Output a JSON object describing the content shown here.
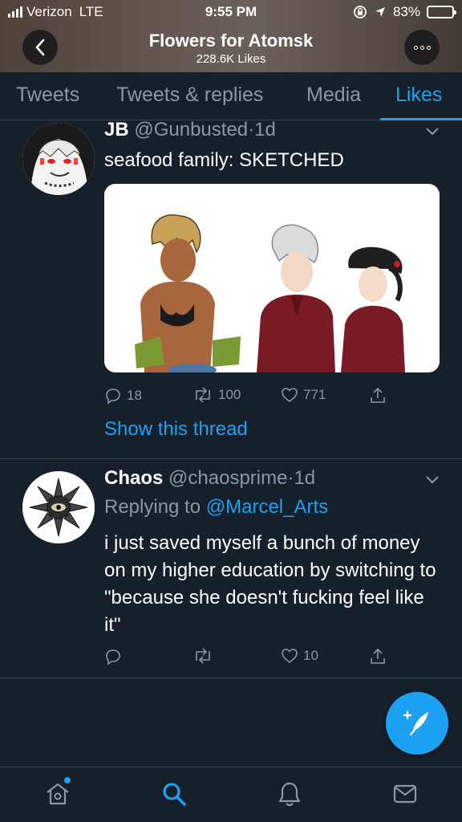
{
  "status_bar": {
    "carrier": "Verizon",
    "network": "LTE",
    "time": "9:55 PM",
    "battery": "83%",
    "battery_level": 0.83
  },
  "profile": {
    "name": "Flowers for Atomsk",
    "likes": "228.6K Likes"
  },
  "tabs": [
    {
      "label": "Tweets"
    },
    {
      "label": "Tweets & replies"
    },
    {
      "label": "Media"
    },
    {
      "label": "Likes",
      "active": true
    }
  ],
  "tweets": [
    {
      "name": "JB",
      "handle": "@Gunbusted",
      "separator": "·",
      "time": "1d",
      "text": "seafood family: SKETCHED",
      "replies": "18",
      "retweets": "100",
      "likes": "771",
      "show_thread": "Show this thread"
    },
    {
      "name": "Chaos",
      "handle": "@chaosprime",
      "separator": "·",
      "time": "1d",
      "replying_label": "Replying to",
      "replying_to": "@Marcel_Arts",
      "text": "i just saved myself a bunch of money on my higher education by switching to \"because she doesn't fucking feel like it\"",
      "replies": "",
      "retweets": "",
      "likes": "10"
    }
  ],
  "icons": {
    "back": "chevron-left-icon",
    "more": "more-options-icon",
    "compose": "compose-tweet-icon",
    "nav": [
      "home-icon",
      "search-icon",
      "notifications-icon",
      "messages-icon"
    ]
  },
  "colors": {
    "accent": "#1da1f2",
    "background": "#15202b",
    "muted": "#8899a6"
  }
}
